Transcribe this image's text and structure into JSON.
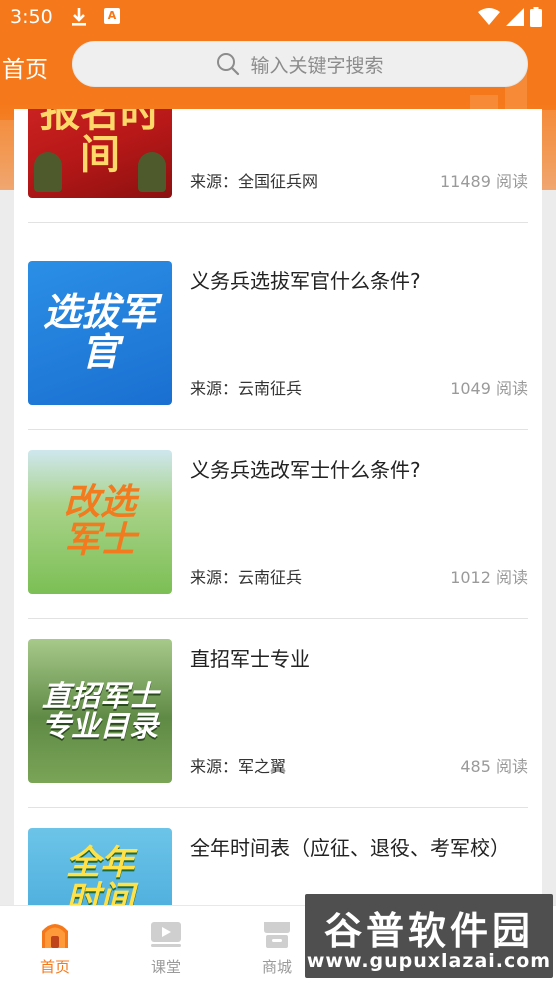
{
  "status_bar": {
    "time": "3:50"
  },
  "header": {
    "title": "首页",
    "search": {
      "placeholder": "输入关键字搜索"
    }
  },
  "articles": [
    {
      "thumb_text": "报名时间",
      "title": "",
      "source": "来源：全国征兵网",
      "reads": "11489 阅读"
    },
    {
      "thumb_text": "选拔军官",
      "title": "义务兵选拔军官什么条件?",
      "source": "来源：云南征兵",
      "reads": "1049 阅读"
    },
    {
      "thumb_text": "改选军士",
      "title": "义务兵选改军士什么条件?",
      "source": "来源：云南征兵",
      "reads": "1012 阅读"
    },
    {
      "thumb_text": "直招军士专业目录",
      "title": "直招军士专业",
      "source": "来源：军之翼",
      "reads": "485 阅读"
    },
    {
      "thumb_text": "全年时间表",
      "title": "全年时间表（应征、退役、考军校）",
      "source": "",
      "reads": ""
    }
  ],
  "bottom_nav": [
    {
      "label": "首页",
      "icon": "home-icon",
      "active": true
    },
    {
      "label": "课堂",
      "icon": "play-video-icon",
      "active": false
    },
    {
      "label": "商城",
      "icon": "store-icon",
      "active": false
    }
  ],
  "watermark": {
    "title": "谷普软件园",
    "url": "www.gupuxlazai.com"
  },
  "colors": {
    "accent": "#f5791a",
    "header_bg": "#f5791a",
    "background": "#ececec"
  }
}
